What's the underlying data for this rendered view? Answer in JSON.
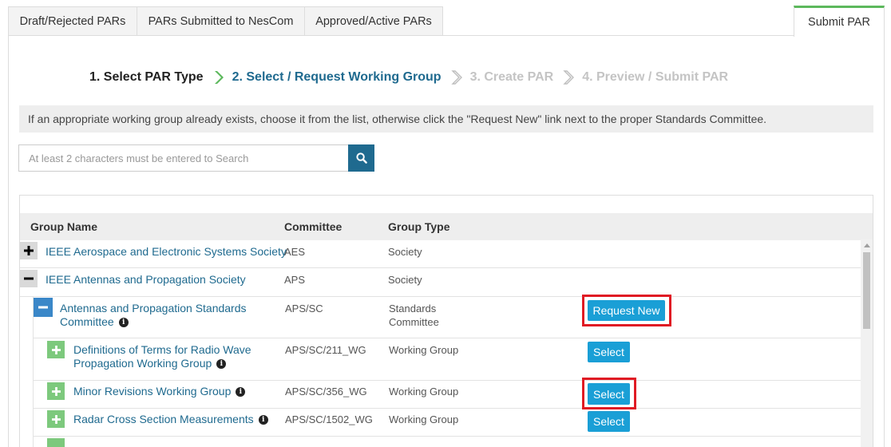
{
  "tabs": [
    {
      "label": "Draft/Rejected PARs"
    },
    {
      "label": "PARs Submitted to NesCom"
    },
    {
      "label": "Approved/Active PARs"
    },
    {
      "label": "Submit PAR"
    }
  ],
  "steps": [
    {
      "label": "1. Select PAR Type",
      "state": "done"
    },
    {
      "label": "2. Select / Request Working Group",
      "state": "current"
    },
    {
      "label": "3. Create PAR",
      "state": "upcoming"
    },
    {
      "label": "4. Preview / Submit PAR",
      "state": "upcoming"
    }
  ],
  "info_text": "If an appropriate working group already exists, choose it from the list, otherwise click the \"Request New\" link next to the proper Standards Committee.",
  "search": {
    "placeholder": "At least 2 characters must be entered to Search",
    "icon": "search-icon"
  },
  "table": {
    "headers": {
      "group_name": "Group Name",
      "committee": "Committee",
      "group_type": "Group Type"
    },
    "rows": [
      {
        "name": "IEEE Aerospace and Electronic Systems Society",
        "committee": "AES",
        "type": "Society",
        "toggle": "+"
      },
      {
        "name": "IEEE Antennas and Propagation Society",
        "committee": "APS",
        "type": "Society",
        "toggle": "−"
      },
      {
        "name_line1": "Antennas and Propagation Standards",
        "name_line2": "Committee",
        "committee": "APS/SC",
        "type_line1": "Standards",
        "type_line2": "Committee",
        "toggle": "−",
        "action": "Request New"
      },
      {
        "name_line1": "Definitions of Terms for Radio Wave",
        "name_line2": "Propagation Working Group",
        "committee": "APS/SC/211_WG",
        "type": "Working Group",
        "toggle": "+",
        "action": "Select"
      },
      {
        "name": "Minor Revisions Working Group",
        "committee": "APS/SC/356_WG",
        "type": "Working Group",
        "toggle": "+",
        "action": "Select"
      },
      {
        "name": "Radar Cross Section Measurements",
        "committee": "APS/SC/1502_WG",
        "type": "Working Group",
        "toggle": "+",
        "action": "Select"
      }
    ]
  },
  "colors": {
    "accent": "#1f6a8f",
    "button": "#1a9fd6",
    "highlight": "#e01b24",
    "active_tab": "#5cb85c"
  }
}
